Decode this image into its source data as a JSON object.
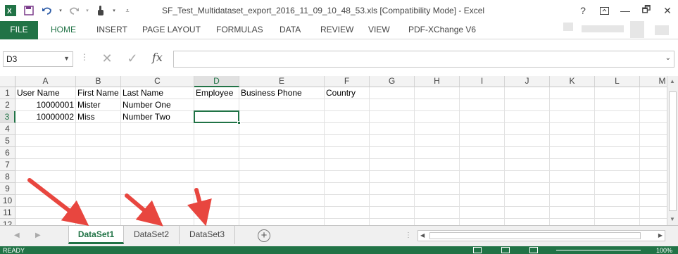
{
  "window": {
    "title": "SF_Test_Multidataset_export_2016_11_09_10_48_53.xls  [Compatibility Mode] - Excel",
    "help_label": "?",
    "restore_label": "🗗",
    "minimize_label": "—",
    "close_label": "✕"
  },
  "ribbon": {
    "tabs": [
      "FILE",
      "HOME",
      "INSERT",
      "PAGE LAYOUT",
      "FORMULAS",
      "DATA",
      "REVIEW",
      "VIEW",
      "PDF-XChange V6"
    ],
    "active_tab": "HOME"
  },
  "formula_bar": {
    "name_box": "D3",
    "fx_label": "fx",
    "value": ""
  },
  "columns": [
    {
      "label": "A",
      "w": 86
    },
    {
      "label": "B",
      "w": 64
    },
    {
      "label": "C",
      "w": 104
    },
    {
      "label": "D",
      "w": 64
    },
    {
      "label": "E",
      "w": 121
    },
    {
      "label": "F",
      "w": 64
    },
    {
      "label": "G",
      "w": 64
    },
    {
      "label": "H",
      "w": 64
    },
    {
      "label": "I",
      "w": 64
    },
    {
      "label": "J",
      "w": 64
    },
    {
      "label": "K",
      "w": 64
    },
    {
      "label": "L",
      "w": 64
    },
    {
      "label": "M",
      "w": 64
    }
  ],
  "rows": [
    "1",
    "2",
    "3",
    "4",
    "5",
    "6",
    "7",
    "8",
    "9",
    "10",
    "11",
    "12"
  ],
  "selected": {
    "col": "D",
    "row": "3"
  },
  "cells": [
    {
      "r": 0,
      "c": 0,
      "v": "User Name",
      "num": false
    },
    {
      "r": 0,
      "c": 1,
      "v": "First Name",
      "num": false
    },
    {
      "r": 0,
      "c": 2,
      "v": "Last Name",
      "num": false
    },
    {
      "r": 0,
      "c": 3,
      "v": "Employee",
      "num": false
    },
    {
      "r": 0,
      "c": 4,
      "v": "Business Phone",
      "num": false
    },
    {
      "r": 0,
      "c": 5,
      "v": "Country",
      "num": false
    },
    {
      "r": 1,
      "c": 0,
      "v": "10000001",
      "num": true
    },
    {
      "r": 1,
      "c": 1,
      "v": "Mister",
      "num": false
    },
    {
      "r": 1,
      "c": 2,
      "v": "Number One",
      "num": false
    },
    {
      "r": 2,
      "c": 0,
      "v": "10000002",
      "num": true
    },
    {
      "r": 2,
      "c": 1,
      "v": "Miss",
      "num": false
    },
    {
      "r": 2,
      "c": 2,
      "v": "Number Two",
      "num": false
    }
  ],
  "sheets": [
    "DataSet1",
    "DataSet2",
    "DataSet3"
  ],
  "active_sheet": "DataSet1",
  "status": {
    "ready": "READY",
    "zoom": "100%"
  },
  "colors": {
    "accent": "#217346",
    "annotation_arrow": "#e8463f"
  }
}
